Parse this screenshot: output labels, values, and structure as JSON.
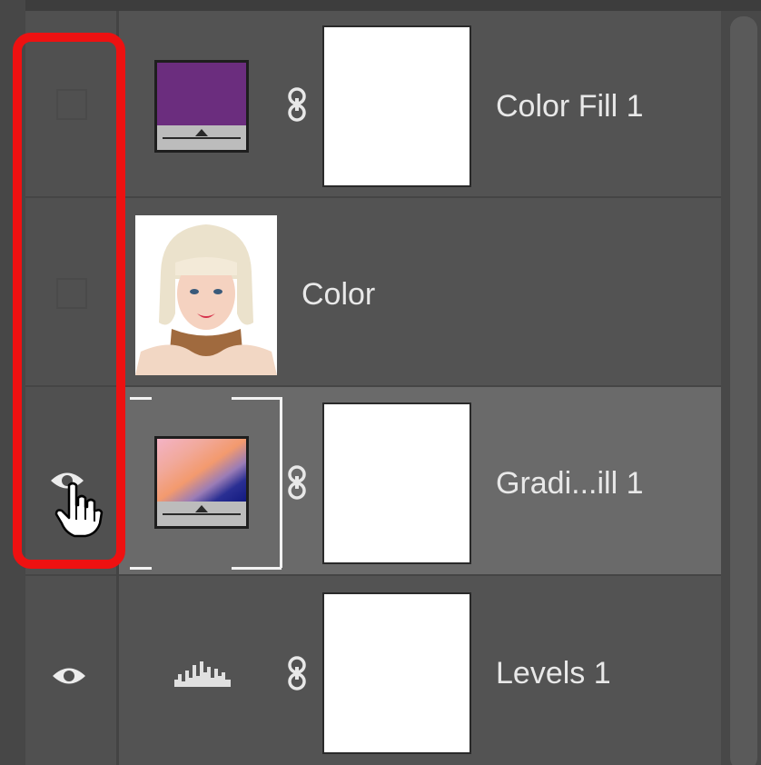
{
  "layers": [
    {
      "name": "Color Fill 1",
      "visible": false,
      "type": "color-fill",
      "fill_color": "#6b2d7e"
    },
    {
      "name": "Color",
      "visible": false,
      "type": "image"
    },
    {
      "name": "Gradi...ill 1",
      "visible": true,
      "type": "gradient-fill",
      "selected": true
    },
    {
      "name": "Levels 1",
      "visible": true,
      "type": "levels"
    }
  ],
  "colors": {
    "panel_bg": "#535353",
    "selected_row_bg": "#6a6a6a",
    "highlight_outline": "#ee1111",
    "text": "#e8e8e8"
  },
  "icons": [
    "eye-icon",
    "chain-link-icon",
    "hand-cursor-icon",
    "histogram-icon"
  ]
}
